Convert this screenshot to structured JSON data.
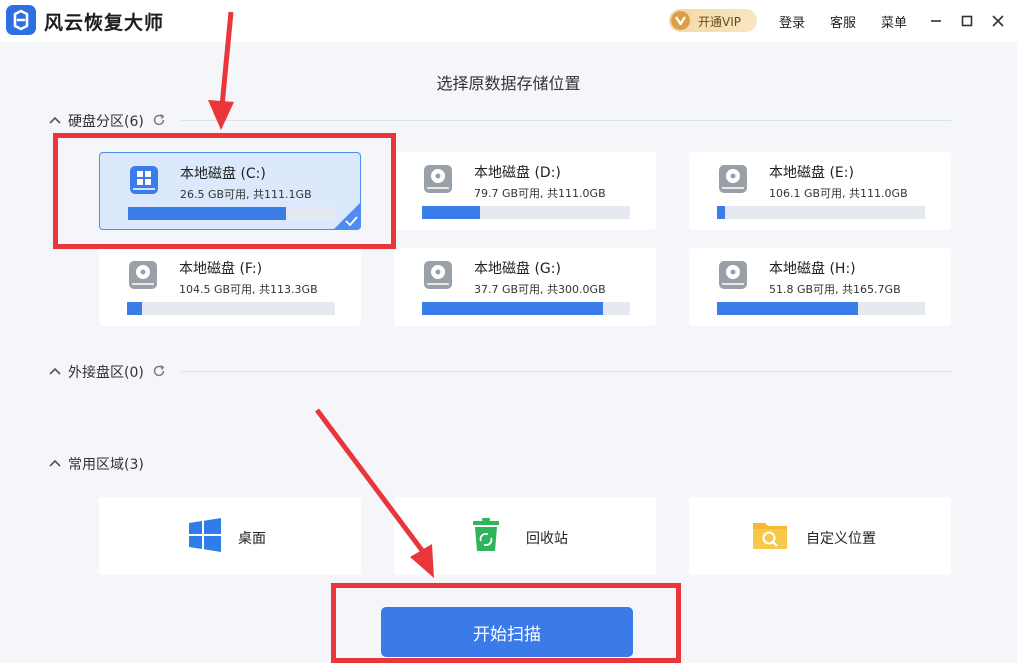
{
  "app": {
    "title": "风云恢复大师"
  },
  "header": {
    "vip_label": "开通VIP",
    "login_label": "登录",
    "service_label": "客服",
    "menu_label": "菜单"
  },
  "main": {
    "title": "选择原数据存储位置"
  },
  "sections": {
    "disk": {
      "label": "硬盘分区(6)"
    },
    "external": {
      "label": "外接盘区(0)"
    },
    "common": {
      "label": "常用区域(3)"
    }
  },
  "drives": [
    {
      "name": "本地磁盘 (C:)",
      "info": "26.5 GB可用, 共111.1GB",
      "used_fraction": 0.76,
      "selected": true
    },
    {
      "name": "本地磁盘 (D:)",
      "info": "79.7 GB可用, 共111.0GB",
      "used_fraction": 0.28,
      "selected": false
    },
    {
      "name": "本地磁盘 (E:)",
      "info": "106.1 GB可用, 共111.0GB",
      "used_fraction": 0.04,
      "selected": false
    },
    {
      "name": "本地磁盘 (F:)",
      "info": "104.5 GB可用, 共113.3GB",
      "used_fraction": 0.07,
      "selected": false
    },
    {
      "name": "本地磁盘 (G:)",
      "info": "37.7 GB可用, 共300.0GB",
      "used_fraction": 0.87,
      "selected": false
    },
    {
      "name": "本地磁盘 (H:)",
      "info": "51.8 GB可用, 共165.7GB",
      "used_fraction": 0.68,
      "selected": false
    }
  ],
  "areas": [
    {
      "label": "桌面",
      "icon": "windows-icon"
    },
    {
      "label": "回收站",
      "icon": "recycle-bin-icon"
    },
    {
      "label": "自定义位置",
      "icon": "folder-search-icon"
    }
  ],
  "scan_button": {
    "label": "开始扫描"
  },
  "colors": {
    "accent": "#3b7be9",
    "selected_bg": "#dce8fb",
    "highlight": "#e8363a",
    "vip_gold": "#d9a04a"
  }
}
